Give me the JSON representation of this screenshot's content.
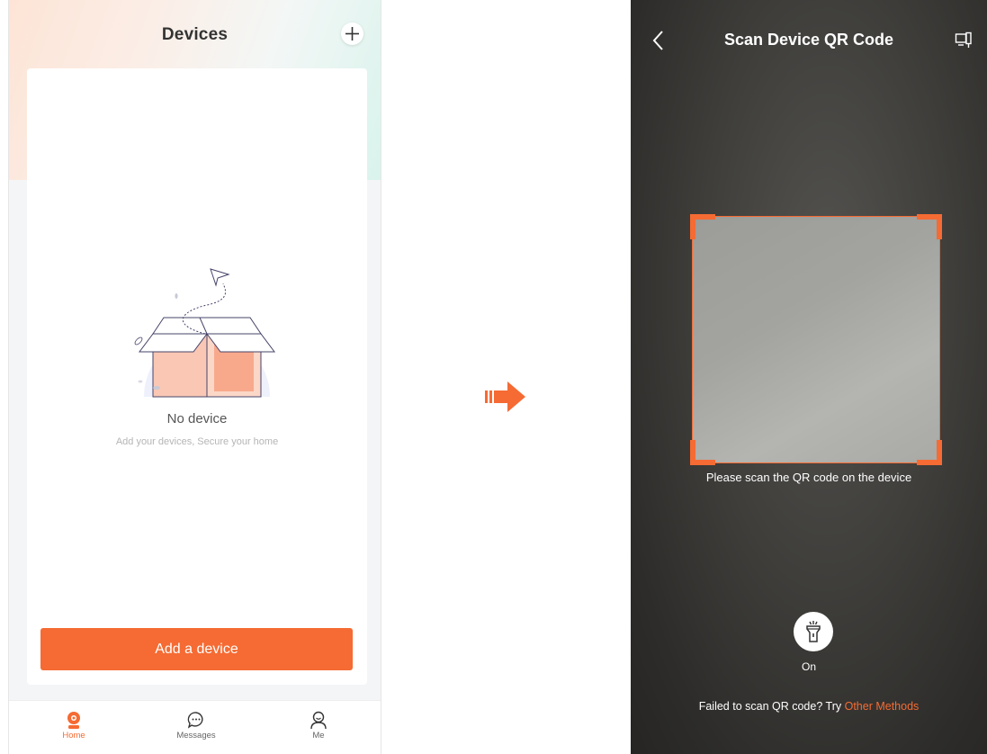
{
  "left_screen": {
    "header": {
      "title": "Devices",
      "add_icon": "plus-icon"
    },
    "empty_state": {
      "title": "No device",
      "subtitle": "Add your devices, Secure your home",
      "illustration": "open-box-with-paper-plane"
    },
    "add_button_label": "Add a device",
    "tabbar": [
      {
        "label": "Home",
        "icon": "camera-icon",
        "active": true
      },
      {
        "label": "Messages",
        "icon": "chat-bubble-icon",
        "active": false
      },
      {
        "label": "Me",
        "icon": "person-icon",
        "active": false
      }
    ]
  },
  "transition_icon": "arrow-right-icon",
  "right_screen": {
    "header": {
      "back_icon": "chevron-left-icon",
      "title": "Scan Device QR Code",
      "mode_icon": "device-switch-icon"
    },
    "scan_hint": "Please scan the QR code on the device",
    "torch": {
      "icon": "flashlight-icon",
      "label": "On"
    },
    "fallback": {
      "prefix": "Failed to scan QR code? Try ",
      "link": "Other Methods"
    }
  },
  "colors": {
    "accent": "#f56b33",
    "dark_background": "#3f3e3b",
    "text_dark": "#333333",
    "text_muted": "#b5b5b5"
  }
}
